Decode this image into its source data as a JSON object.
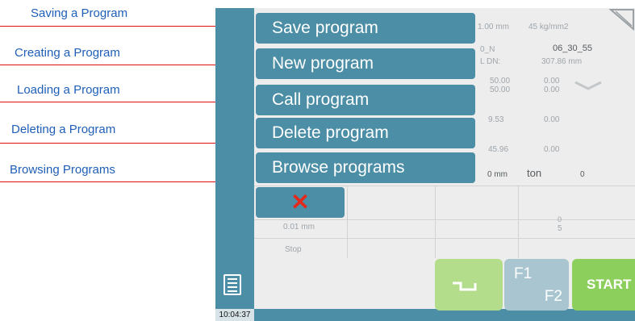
{
  "annotations": [
    {
      "label": "Saving a Program"
    },
    {
      "label": "Creating a Program"
    },
    {
      "label": "Loading a Program"
    },
    {
      "label": "Deleting a Program"
    },
    {
      "label": "Browsing Programs"
    }
  ],
  "menu": {
    "items": [
      {
        "label": "Save program"
      },
      {
        "label": "New program"
      },
      {
        "label": "Call program"
      },
      {
        "label": "Delete program"
      },
      {
        "label": "Browse programs"
      }
    ],
    "cancel_label": "✕"
  },
  "background": {
    "thickness": "1.00 mm",
    "strength": "45 kg/mm2",
    "program_name_partial": "0_N",
    "program_id": "06_30_55",
    "label_l_dn": "L  DN:",
    "length": "307.86 mm",
    "val_50_a": "50.00",
    "val_50_b": "50.00",
    "val_0_a": "0.00",
    "val_0_b": "0.00",
    "val_53": "9.53",
    "val_0_c": "0.00",
    "val_596": "45.96",
    "val_0_d": "0.00",
    "zero_mm": "0 mm",
    "ton_label": "ton",
    "ton_value": "0",
    "mm_value": "0.01 mm",
    "count_0": "0",
    "count_5": "5",
    "stop_label": "Stop"
  },
  "buttons": {
    "f1": "F1",
    "f2": "F2",
    "start": "START"
  },
  "status": {
    "clock": "10:04:37"
  },
  "colors": {
    "panel": "#4b8ea6",
    "annotation_text": "#1f5fb8",
    "arrow": "#e01010",
    "start": "#8ccf5c",
    "back": "#b3dd8a",
    "fkey": "#a9c6d0",
    "cancel_x": "#e3281c"
  },
  "icons": [
    "document-icon",
    "close-icon",
    "back-arrow-icon",
    "bend-icon",
    "corner-logo-icon"
  ]
}
